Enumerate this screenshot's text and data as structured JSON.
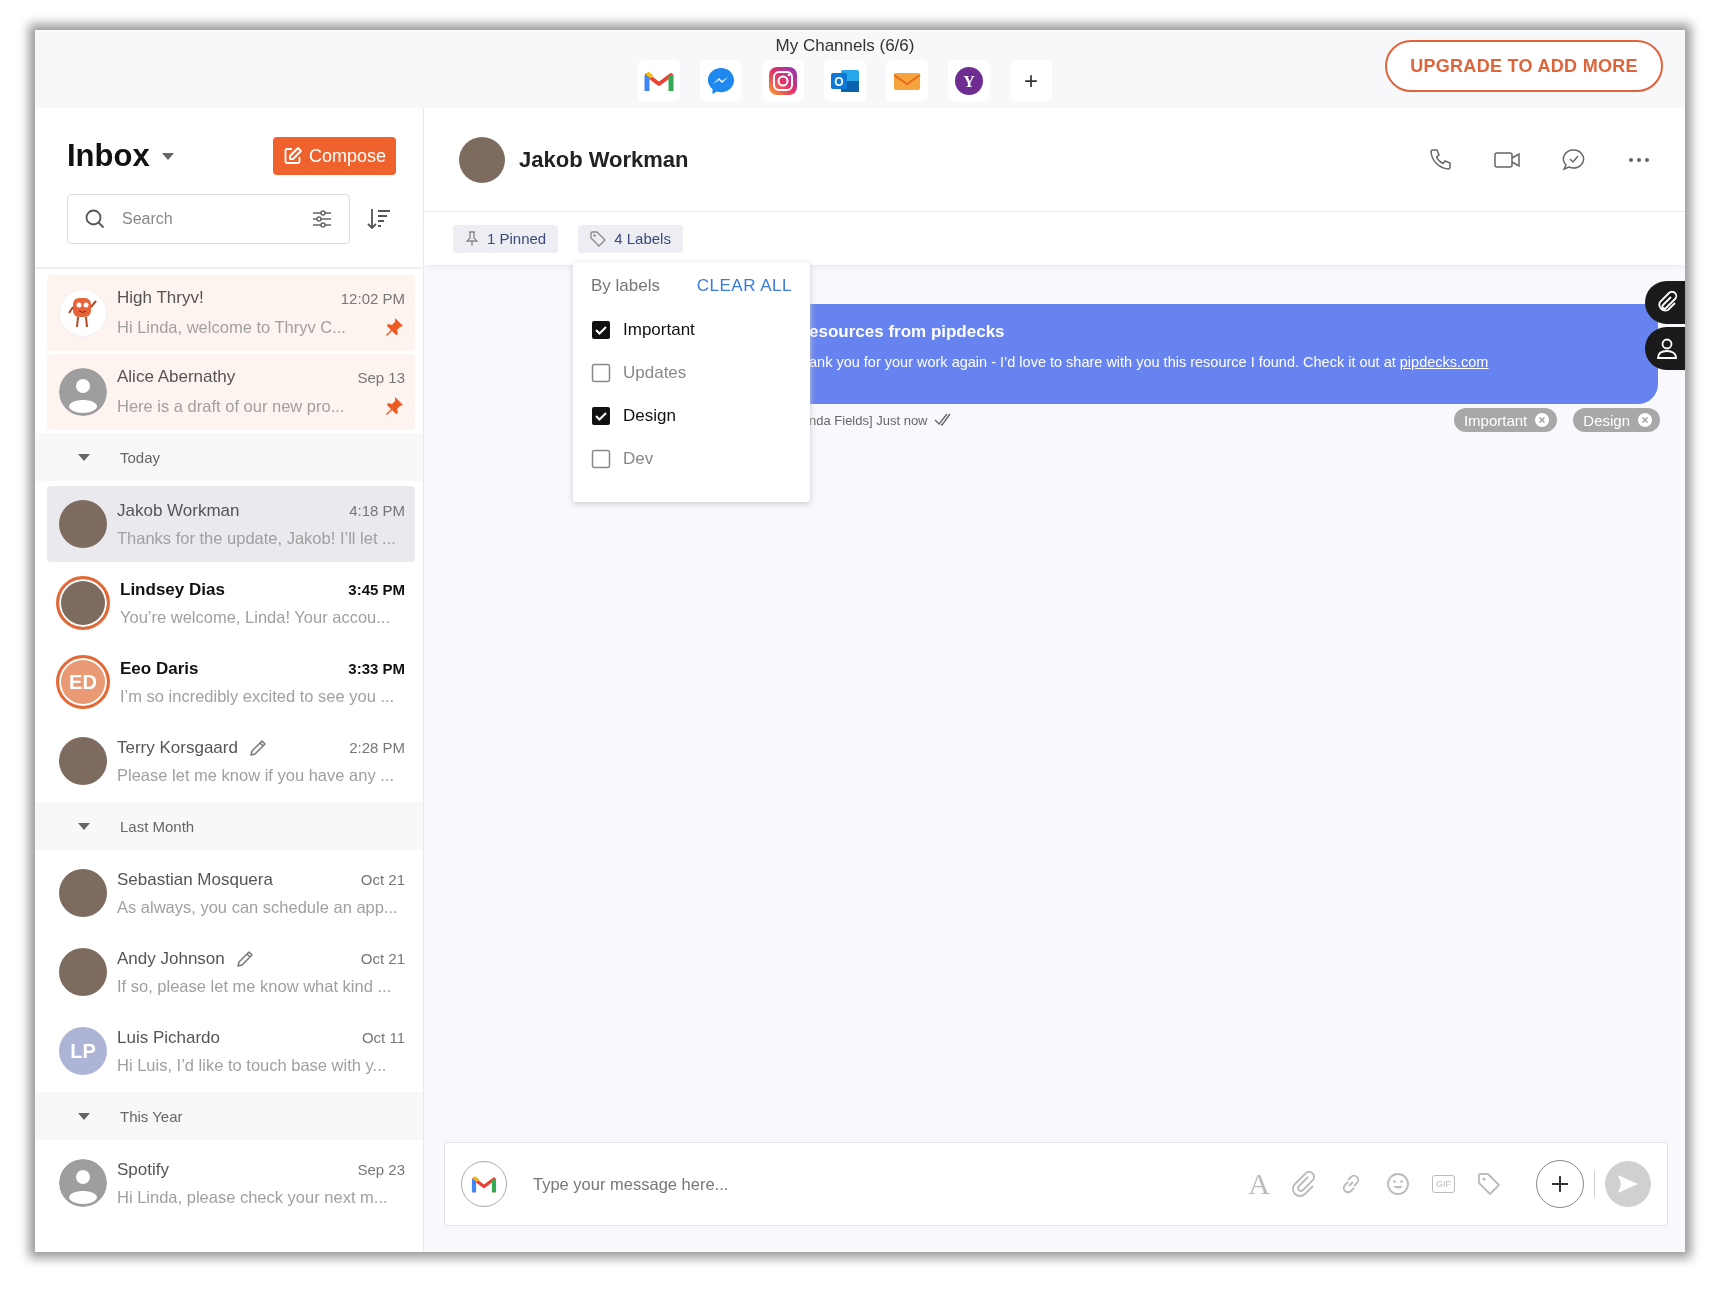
{
  "top_bar": {
    "title": "My Channels (6/6)",
    "channels": [
      {
        "kind": "gmail"
      },
      {
        "kind": "messenger"
      },
      {
        "kind": "instagram"
      },
      {
        "kind": "outlook",
        "label": "O"
      },
      {
        "kind": "email"
      },
      {
        "kind": "yahoo",
        "label": "Y"
      },
      {
        "kind": "add",
        "label": "+"
      }
    ],
    "upgrade_button": "UPGRADE TO ADD MORE"
  },
  "inbox": {
    "title": "Inbox",
    "compose_button": "Compose",
    "search": {
      "placeholder": "Search"
    }
  },
  "conversations": {
    "sections": [
      {
        "items": [
          {
            "name": "High Thryv!",
            "time": "12:02 PM",
            "preview": "Hi Linda, welcome to Thryv C...",
            "avatar": {
              "kind": "mascot"
            },
            "pinned": true,
            "unread": false,
            "selected": false,
            "draft": false
          },
          {
            "name": "Alice Abernathy",
            "time": "Sep 13",
            "preview": "Here is a draft of our new pro...",
            "avatar": {
              "kind": "silhouette"
            },
            "pinned": true,
            "unread": false,
            "selected": false,
            "draft": false
          }
        ]
      },
      {
        "title": "Today",
        "expanded": true,
        "items": [
          {
            "name": "Jakob Workman",
            "time": "4:18 PM",
            "preview": "Thanks for the update, Jakob! I’ll let ...",
            "avatar": {
              "kind": "photo"
            },
            "pinned": false,
            "unread": false,
            "selected": true,
            "draft": false
          },
          {
            "name": "Lindsey Dias",
            "time": "3:45 PM",
            "preview": "You’re welcome, Linda! Your accou...",
            "avatar": {
              "kind": "photo"
            },
            "pinned": false,
            "unread": true,
            "selected": false,
            "draft": false
          },
          {
            "name": "Eeo Daris",
            "time": "3:33 PM",
            "preview": "I’m so incredibly excited to see you ...",
            "avatar": {
              "kind": "initials",
              "initials": "ED",
              "color": "#e99a74"
            },
            "pinned": false,
            "unread": true,
            "selected": false,
            "draft": false
          },
          {
            "name": "Terry Korsgaard",
            "time": "2:28 PM",
            "preview": "Please let me know if you have any ...",
            "avatar": {
              "kind": "photo"
            },
            "pinned": false,
            "unread": false,
            "selected": false,
            "draft": true
          }
        ]
      },
      {
        "title": "Last Month",
        "expanded": true,
        "items": [
          {
            "name": "Sebastian Mosquera",
            "time": "Oct 21",
            "preview": "As always, you can schedule an app...",
            "avatar": {
              "kind": "photo"
            },
            "pinned": false,
            "unread": false,
            "selected": false,
            "draft": false
          },
          {
            "name": "Andy Johnson",
            "time": "Oct 21",
            "preview": "If so, please let me know what kind ...",
            "avatar": {
              "kind": "photo"
            },
            "pinned": false,
            "unread": false,
            "selected": false,
            "draft": true
          },
          {
            "name": "Luis Pichardo",
            "time": "Oct 11",
            "preview": "Hi Luis, I’d like to touch base with y...",
            "avatar": {
              "kind": "initials",
              "initials": "LP",
              "color": "#aeb4d6"
            },
            "pinned": false,
            "unread": false,
            "selected": false,
            "draft": false
          }
        ]
      },
      {
        "title": "This Year",
        "expanded": true,
        "items": [
          {
            "name": "Spotify",
            "time": "Sep 23",
            "preview": "Hi Linda, please check your next m...",
            "avatar": {
              "kind": "silhouette"
            },
            "pinned": false,
            "unread": false,
            "selected": false,
            "draft": false
          }
        ]
      }
    ]
  },
  "chat": {
    "contact": "Jakob Workman",
    "pinned_chip": "1 Pinned",
    "labels_chip": "4 Labels",
    "labels_menu": {
      "open": true,
      "title": "By labels",
      "clear_all": "CLEAR ALL",
      "options": [
        {
          "label": "Important",
          "checked": true
        },
        {
          "label": "Updates",
          "checked": false
        },
        {
          "label": "Design",
          "checked": true
        },
        {
          "label": "Dev",
          "checked": false
        }
      ]
    },
    "message": {
      "title": "esources from pipdecks",
      "body": "ank you for your work again - I’d love to share with you this resource I found. Check it out at",
      "link": "pipdecks.com",
      "meta": "nda Fields] Just now",
      "tags": [
        "Important",
        "Design"
      ]
    },
    "composer": {
      "placeholder": "Type your message here...",
      "tools": [
        {
          "kind": "format",
          "label": "A"
        },
        {
          "kind": "attach"
        },
        {
          "kind": "link"
        },
        {
          "kind": "emoji"
        },
        {
          "kind": "gif",
          "label": "GIF"
        },
        {
          "kind": "tag"
        }
      ]
    }
  }
}
